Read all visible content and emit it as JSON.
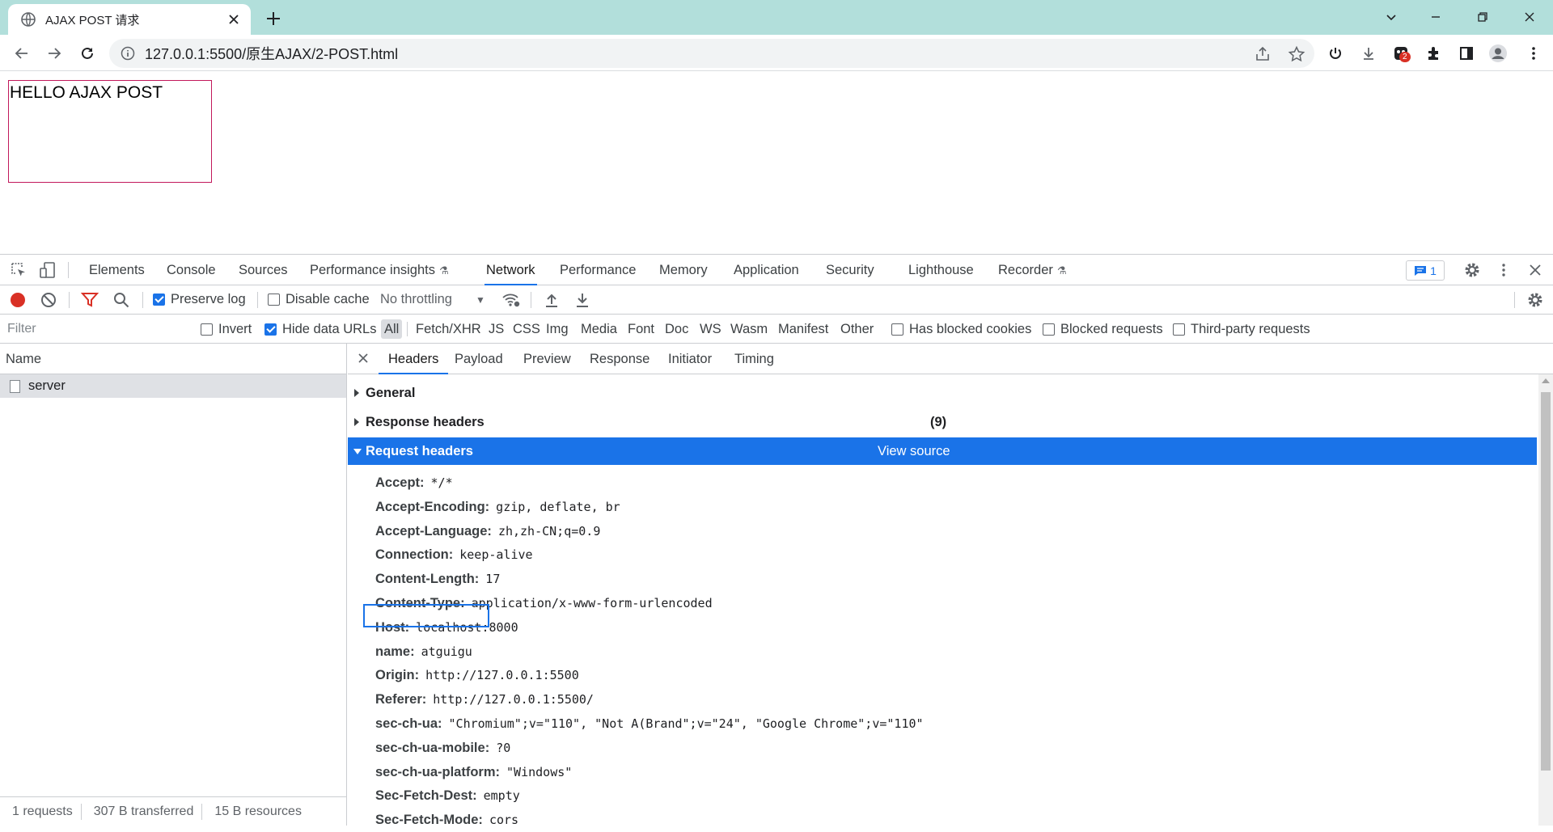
{
  "browser": {
    "tab_title": "AJAX POST 请求",
    "url": "127.0.0.1:5500/原生AJAX/2-POST.html",
    "extension_badge": "2"
  },
  "page": {
    "result_text": "HELLO AJAX POST"
  },
  "devtools": {
    "tabs": [
      "Elements",
      "Console",
      "Sources",
      "Performance insights",
      "Network",
      "Performance",
      "Memory",
      "Application",
      "Security",
      "Lighthouse",
      "Recorder"
    ],
    "active_tab": "Network",
    "messages_count": "1",
    "network_toolbar": {
      "preserve_log": "Preserve log",
      "disable_cache": "Disable cache",
      "throttling": "No throttling"
    },
    "filter": {
      "placeholder": "Filter",
      "invert": "Invert",
      "hide_data_urls": "Hide data URLs",
      "types": [
        "All",
        "Fetch/XHR",
        "JS",
        "CSS",
        "Img",
        "Media",
        "Font",
        "Doc",
        "WS",
        "Wasm",
        "Manifest",
        "Other"
      ],
      "has_blocked_cookies": "Has blocked cookies",
      "blocked_requests": "Blocked requests",
      "third_party": "Third-party requests"
    },
    "request_list": {
      "header": "Name",
      "rows": [
        "server"
      ]
    },
    "summary": {
      "requests": "1 requests",
      "transferred": "307 B transferred",
      "resources": "15 B resources"
    },
    "details": {
      "tabs": [
        "Headers",
        "Payload",
        "Preview",
        "Response",
        "Initiator",
        "Timing"
      ],
      "active_tab": "Headers",
      "general": "General",
      "response_headers": "Response headers",
      "response_count": "(9)",
      "request_headers": "Request headers",
      "view_source": "View source",
      "headers": [
        {
          "k": "Accept:",
          "v": "*/*"
        },
        {
          "k": "Accept-Encoding:",
          "v": "gzip, deflate, br"
        },
        {
          "k": "Accept-Language:",
          "v": "zh,zh-CN;q=0.9"
        },
        {
          "k": "Connection:",
          "v": "keep-alive"
        },
        {
          "k": "Content-Length:",
          "v": "17"
        },
        {
          "k": "Content-Type:",
          "v": "application/x-www-form-urlencoded"
        },
        {
          "k": "Host:",
          "v": "localhost:8000"
        },
        {
          "k": "name:",
          "v": "atguigu"
        },
        {
          "k": "Origin:",
          "v": "http://127.0.0.1:5500"
        },
        {
          "k": "Referer:",
          "v": "http://127.0.0.1:5500/"
        },
        {
          "k": "sec-ch-ua:",
          "v": "\"Chromium\";v=\"110\", \"Not A(Brand\";v=\"24\", \"Google Chrome\";v=\"110\""
        },
        {
          "k": "sec-ch-ua-mobile:",
          "v": "?0"
        },
        {
          "k": "sec-ch-ua-platform:",
          "v": "\"Windows\""
        },
        {
          "k": "Sec-Fetch-Dest:",
          "v": "empty"
        },
        {
          "k": "Sec-Fetch-Mode:",
          "v": "cors"
        }
      ]
    }
  },
  "colors": {
    "tabstrip": "#b2dfdb",
    "accent": "#1a73e8",
    "result_border": "#c2185b",
    "record": "#d93025"
  }
}
